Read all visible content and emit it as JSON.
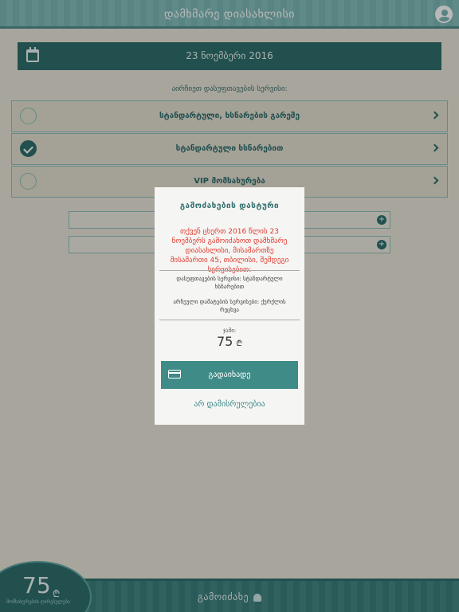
{
  "header": {
    "title": "დამხმარე დიასახლისი",
    "avatar": "user-icon"
  },
  "date": {
    "label": "23 ნოემბერი 2016",
    "icon": "calendar-icon"
  },
  "select_prompt": "აირჩიეთ დასუფთავების სერვისი:",
  "options": [
    {
      "label": "სტანდარტული, ხსნარების გარეშე",
      "checked": false
    },
    {
      "label": "სტანდარტული ხსნარებით",
      "checked": true
    },
    {
      "label": "VIP მომსახურება",
      "checked": false
    }
  ],
  "footer": {
    "order_label": "გამოიძახე",
    "price": "75",
    "currency": "₾",
    "price_caption": "მომსახურების ღირებულება"
  },
  "modal": {
    "title": "გამოძახების დასტური",
    "message": "თქვენ ცხერთ 2016 წლის 23 ნოემბერს გამოიძახოთ დამხმარე დიასახლისი, მისამართზე მისამართი 45, თბილისი, შემდეგი სერვისებით:",
    "detail_service": "დასუფთავების სერვისი: სტანდარტული ხსნარებით",
    "detail_extra": "არჩეული დამატების სერვისები: ქურქლის რეცხვა",
    "sum_label": "ჯამი:",
    "sum_value": "75",
    "currency": "₾",
    "pay_label": "გადაიხადე",
    "cancel_label": "არ დამისრულებია"
  },
  "colors": {
    "accent": "#2f6f6d",
    "header": "#7ab7b4",
    "alert": "#e2392f",
    "button": "#3f8b88"
  }
}
